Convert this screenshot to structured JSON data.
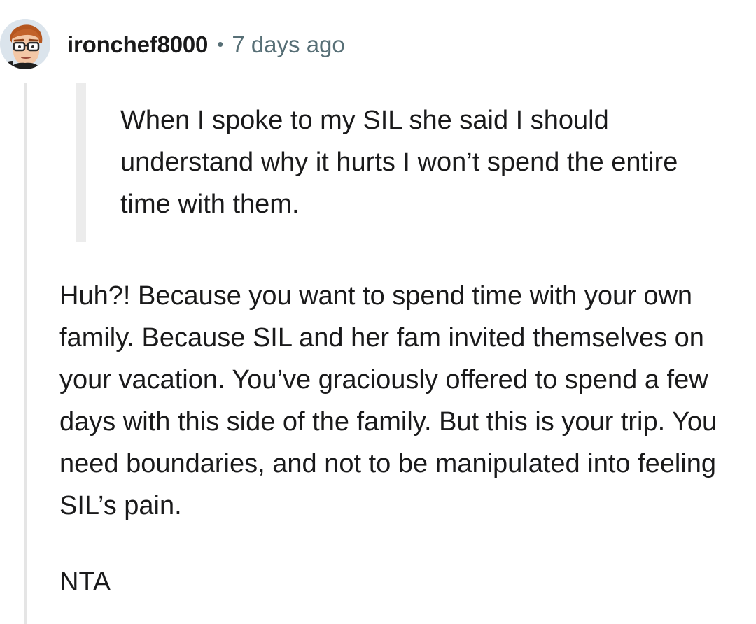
{
  "comment": {
    "avatar_icon": "cartoon-man-with-glasses-avatar",
    "username": "ironchef8000",
    "separator": "•",
    "timestamp": "7 days ago",
    "quote": "When I spoke to my SIL she said I should understand why it hurts I won’t spend the entire time with them.",
    "body": "Huh?! Because you want to spend time with your own family. Because SIL and her fam invited themselves on your vacation. You’ve graciously offered to spend a few days with this side of the family. But this is your trip. You need boundaries, and not to be manipulated into feeling SIL’s pain.",
    "verdict": "NTA"
  },
  "colors": {
    "text": "#1a1a1b",
    "meta": "#576f76",
    "quote_bar": "#ececec",
    "thread_line": "#e5e5e5"
  }
}
